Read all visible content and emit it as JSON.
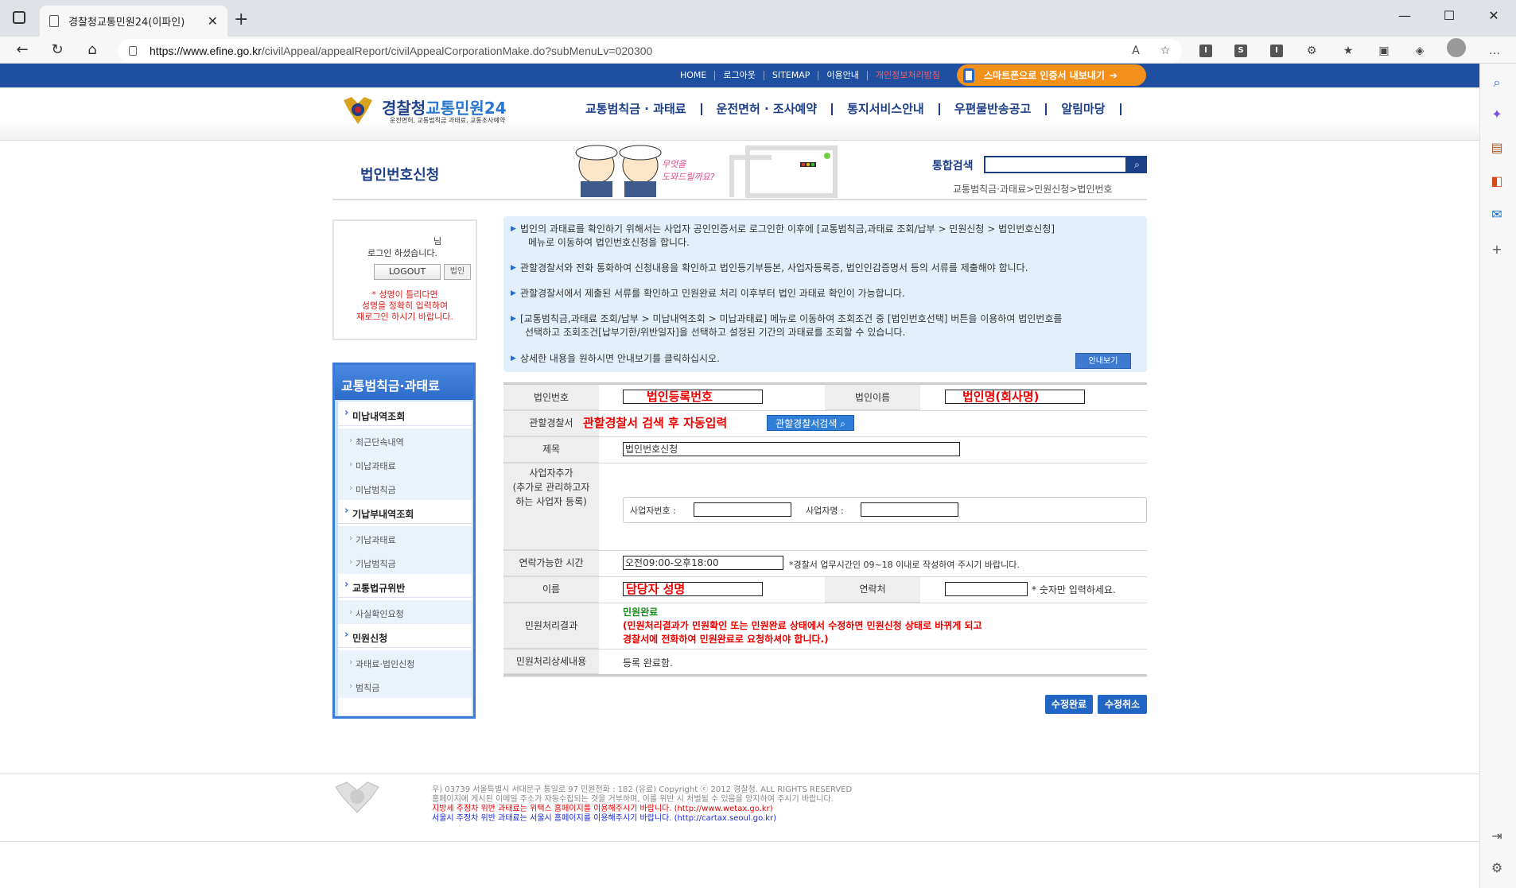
{
  "browser": {
    "tab_title": "경찰청교통민원24(이파인)",
    "url_host": "https://www.efine.go.kr",
    "url_path": "/civilAppeal/appealReport/civilAppealCorporationMake.do?subMenuLv=020300"
  },
  "topnav": {
    "links": [
      "HOME",
      "로그아웃",
      "SITEMAP",
      "이용안내",
      "개인정보처리방침"
    ],
    "smart_button": "스마트폰으로 인증서 내보내기"
  },
  "header": {
    "logo_main": "경찰청",
    "logo_em": "교통민원24",
    "logo_sub": "운전면허, 교통범칙금 과태료, 교통조사예약",
    "menu": [
      "교통범칙금 · 과태료",
      "운전면허 · 조사예약",
      "통지서비스안내",
      "우편물반송공고",
      "알림마당"
    ]
  },
  "page": {
    "title": "법인번호신청",
    "search_label": "통합검색",
    "breadcrumb": "교통범칙금·과태료>민원신청>법인번호"
  },
  "login": {
    "suffix": "님",
    "message": "로그인 하셨습니다.",
    "logout": "LOGOUT",
    "corp": "법인",
    "warn1": "* 성명이 틀리다면",
    "warn2": "성명을 정확히 입력하여",
    "warn3": "재로그인 하시기 바랍니다."
  },
  "lnb": {
    "title": "교통범칙금·과태료",
    "groups": [
      {
        "label": "미납내역조회",
        "items": [
          "최근단속내역",
          "미납과태료",
          "미납범칙금"
        ]
      },
      {
        "label": "기납부내역조회",
        "items": [
          "기납과태료",
          "기납범칙금"
        ]
      },
      {
        "label": "교통법규위반",
        "items": [
          "사실확인요청"
        ]
      },
      {
        "label": "민원신청",
        "items": [
          "과태료·법인신청",
          "범칙금"
        ]
      }
    ]
  },
  "info": {
    "items": [
      [
        "법인의 과태료를 확인하기 위해서는 사업자 공인인증서로 로그인한 이후에 [교통범칙금,과태료 조회/납부 > 민원신청 > 법인번호신청]",
        "메뉴로 이동하여 법인번호신청을 합니다."
      ],
      [
        "관할경찰서와 전화 통화하여 신청내용을 확인하고 법인등기부등본, 사업자등록증, 법인인감증명서 등의 서류를 제출해야 합니다."
      ],
      [
        "관할경찰서에서 제출된 서류를 확인하고 민원완료 처리 이후부터 법인 과태료 확인이 가능합니다."
      ],
      [
        "[교통범칙금,과태료 조회/납부 > 미납내역조회 > 미납과태료] 메뉴로 이동하여 조회조건 중 [법인번호선택] 버튼을 이용하여 법인번호를",
        "선택하고 조회조건[납부기한/위반일자]을 선택하고 설정된 기간의 과태료를 조회할 수 있습니다."
      ],
      [
        "상세한 내용을 원하시면 안내보기를 클릭하십시오."
      ]
    ],
    "guide_button": "안내보기"
  },
  "form": {
    "corp_no_label": "법인번호",
    "corp_no_value": "법인등록번호",
    "corp_name_label": "법인이름",
    "corp_name_value": "법인명(회사명)",
    "police_label": "관할경찰서",
    "police_value": "관할경찰서 검색 후 자동입력",
    "police_button": "관할경찰서검색",
    "subject_label": "제목",
    "subject_value": "법인번호신청",
    "biz_label": "사업자추가\n(추가로 관리하고자\n하는 사업자 등록)",
    "biz_no_label": "사업자번호 :",
    "biz_name_label": "사업자명 :",
    "time_label": "연락가능한 시간",
    "time_value": "오전09:00-오후18:00",
    "time_note": "*경찰서 업무시간인 09~18 이내로 작성하여 주시기 바랍니다.",
    "name_label": "이름",
    "name_value": "담당자 성명",
    "contact_label": "연락처",
    "contact_note": "* 숫자만 입력하세요.",
    "result_label": "민원처리결과",
    "result_value": "민원완료",
    "result_note1": "(민원처리결과가 민원확인 또는 민원완료 상태에서 수정하면 민원신청 상태로 바뀌게 되고",
    "result_note2": "경찰서에 전화하여 민원완료로 요청하셔야 합니다.)",
    "detail_label": "민원처리상세내용",
    "detail_value": "등록 완료함.",
    "ok_button": "수정완료",
    "cancel_button": "수정취소"
  },
  "footer": {
    "line1": "우) 03739 서울특별시 서대문구 통일로 97  민원전화 : 182 (유료)       Copyright ⓒ 2012 경찰청. ALL RIGHTS RESERVED",
    "line2": "홈페이지에 게시된 이메일 주소가 자동수집되는 것을 거부하며, 이를 위반 시 처벌될 수 있음을 양지하여 주시기 바랍니다.",
    "line3": "지방세 주정차 위반 과태료는 위택스 홈페이지를 이용해주시기 바랍니다. (http://www.wetax.go.kr)",
    "line4": "서울시 주정차 위반 과태료는 서울시 홈페이지를 이용해주시기 바랍니다. (http://cartax.seoul.go.kr)"
  }
}
